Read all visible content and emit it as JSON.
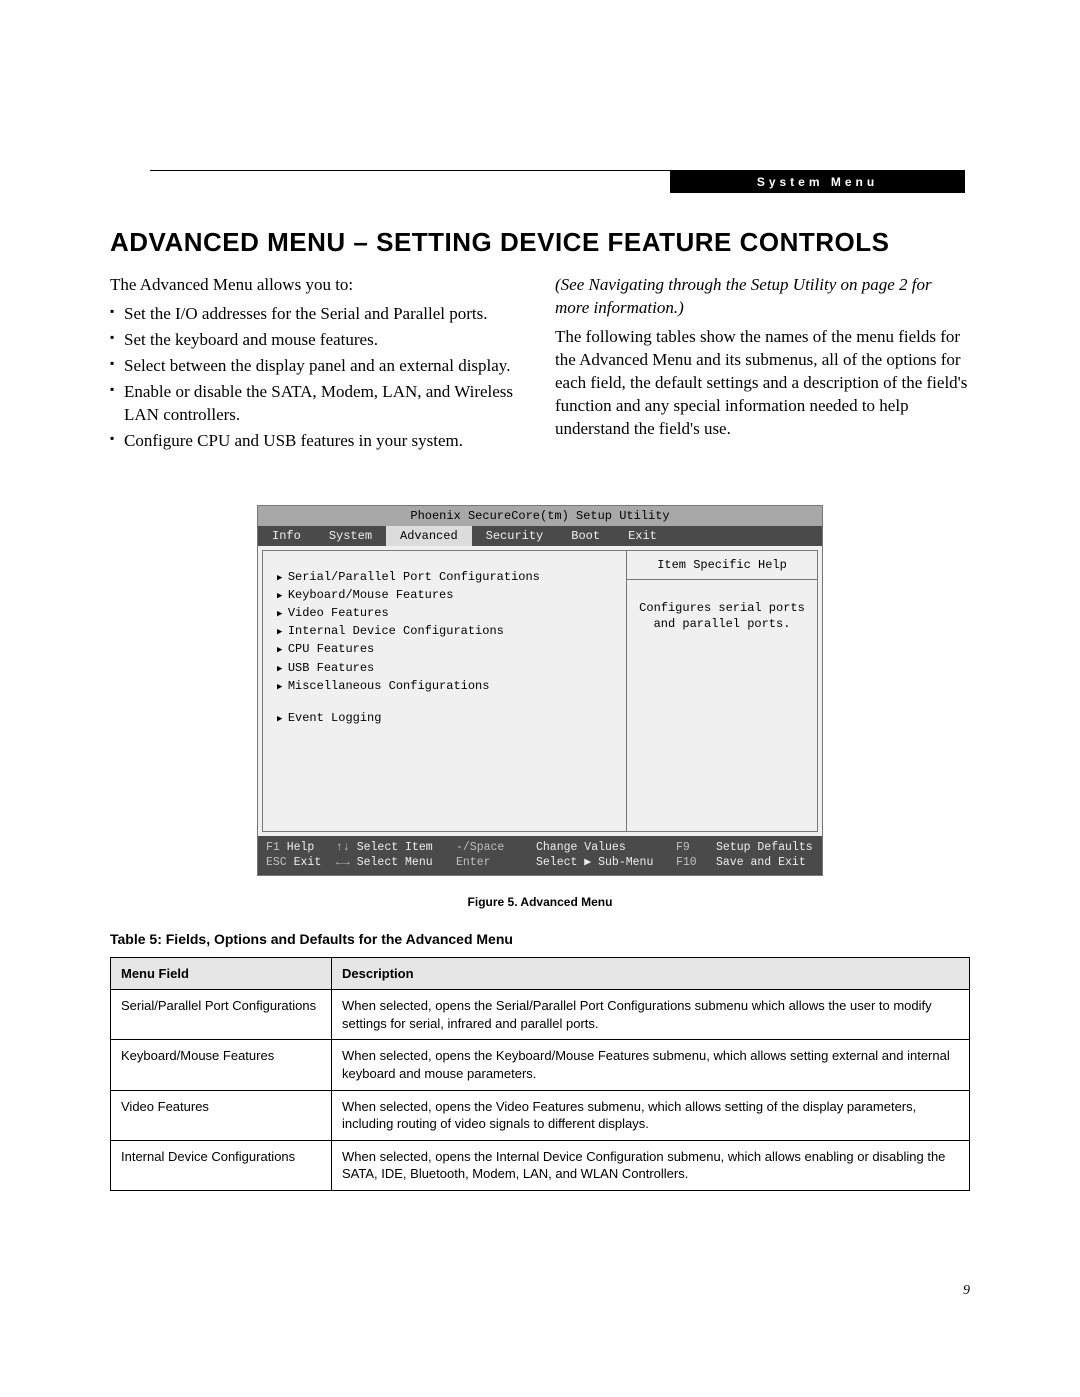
{
  "header_pill": "System Menu",
  "section_title": "ADVANCED MENU – SETTING DEVICE FEATURE CONTROLS",
  "intro": "The Advanced Menu allows you to:",
  "bullets": [
    "Set the I/O addresses for the Serial and Parallel ports.",
    "Set the keyboard and mouse features.",
    "Select between the display panel and an external display.",
    "Enable or disable the SATA, Modem, LAN, and Wireless LAN controllers.",
    "Configure CPU and USB features in your system."
  ],
  "right_italic": "(See Navigating through the Setup Utility on page 2 for more information.)",
  "right_para": "The following tables show the names of the menu fields for the Advanced Menu and its submenus, all of the options for each field, the default settings and a description of the field's function and any special information needed to help understand the field's use.",
  "bios": {
    "title": "Phoenix SecureCore(tm) Setup Utility",
    "tabs": [
      "Info",
      "System",
      "Advanced",
      "Security",
      "Boot",
      "Exit"
    ],
    "active_tab": "Advanced",
    "submenus_a": [
      "Serial/Parallel Port Configurations",
      "Keyboard/Mouse Features",
      "Video Features",
      "Internal Device Configurations",
      "CPU Features",
      "USB Features",
      "Miscellaneous Configurations"
    ],
    "submenus_b": [
      "Event Logging"
    ],
    "help_head": "Item Specific Help",
    "help_text": "Configures serial ports and parallel ports.",
    "footer": {
      "r1": {
        "k1": "F1",
        "l1": "Help",
        "k2": "↑↓",
        "l2": "Select Item",
        "k3": "-/Space",
        "l3": "Change Values",
        "k4": "F9",
        "l4": "Setup Defaults"
      },
      "r2": {
        "k1": "ESC",
        "l1": "Exit",
        "k2": "←→",
        "l2": "Select Menu",
        "k3": "Enter",
        "l3": "Select ▶ Sub-Menu",
        "k4": "F10",
        "l4": "Save and Exit"
      }
    }
  },
  "fig_caption": "Figure 5.  Advanced Menu",
  "table_caption": "Table 5: Fields, Options and Defaults for the Advanced Menu",
  "table": {
    "head_field": "Menu Field",
    "head_desc": "Description",
    "rows": [
      {
        "field": "Serial/Parallel Port Configurations",
        "desc": "When selected, opens the Serial/Parallel Port Configurations submenu which allows the user to modify settings for serial, infrared and parallel ports."
      },
      {
        "field": "Keyboard/Mouse Features",
        "desc": "When selected, opens the Keyboard/Mouse Features submenu, which allows setting external and internal keyboard and mouse parameters."
      },
      {
        "field": "Video Features",
        "desc": "When selected, opens the Video Features submenu, which allows setting of the display parameters, including routing of video signals to different displays."
      },
      {
        "field": "Internal Device Configurations",
        "desc": "When selected, opens the Internal Device Configuration submenu, which allows enabling or disabling the SATA, IDE, Bluetooth, Modem, LAN, and WLAN Controllers."
      }
    ]
  },
  "page_number": "9"
}
